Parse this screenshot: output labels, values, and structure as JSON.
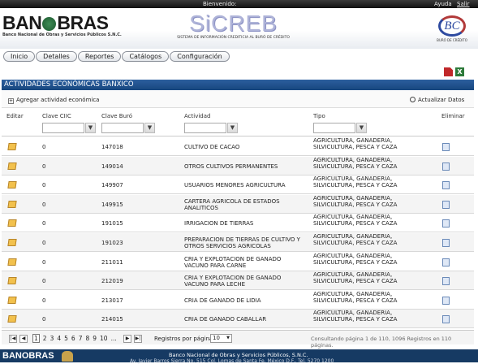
{
  "topbar": {
    "welcome": "Bienvenido:",
    "help": "Ayuda",
    "exit": "Salir"
  },
  "header": {
    "logo_left": "BAN",
    "logo_right": "BRAS",
    "logo_subtitle": "Banco Nacional de Obras y Servicios Públicos S.N.C.",
    "system_logo": "SiCREB",
    "system_subtitle": "SISTEMA DE INFORMACIÓN CREDITICIA AL BURÓ DE CRÉDITO",
    "buro_mark": "BC",
    "buro_subtitle": "BURÓ DE CRÉDITO"
  },
  "nav": [
    "Inicio",
    "Detalles",
    "Reportes",
    "Catálogos",
    "Configuración"
  ],
  "panel": {
    "title": "ACTIVIDADES ECONÓMICAS BANXICO",
    "add_label": "Agregar actividad económica",
    "refresh_label": "Actualizar Datos"
  },
  "columns": {
    "edit": "Editar",
    "clave_ciic": "Clave CIIC",
    "clave_buro": "Clave Buró",
    "actividad": "Actividad",
    "tipo": "Tipo",
    "eliminar": "Eliminar"
  },
  "rows": [
    {
      "ciic": "0",
      "buro": "147018",
      "actividad": "CULTIVO DE CACAO",
      "tipo": "AGRICULTURA, GANADERIA, SILVICULTURA, PESCA Y CAZA"
    },
    {
      "ciic": "0",
      "buro": "149014",
      "actividad": "OTROS CULTIVOS PERMANENTES",
      "tipo": "AGRICULTURA, GANADERIA, SILVICULTURA, PESCA Y CAZA"
    },
    {
      "ciic": "0",
      "buro": "149907",
      "actividad": "USUARIOS MENORES AGRICULTURA",
      "tipo": "AGRICULTURA, GANADERIA, SILVICULTURA, PESCA Y CAZA"
    },
    {
      "ciic": "0",
      "buro": "149915",
      "actividad": "CARTERA AGRICOLA DE ESTADOS ANALITICOS",
      "tipo": "AGRICULTURA, GANADERIA, SILVICULTURA, PESCA Y CAZA"
    },
    {
      "ciic": "0",
      "buro": "191015",
      "actividad": "IRRIGACION DE TIERRAS",
      "tipo": "AGRICULTURA, GANADERIA, SILVICULTURA, PESCA Y CAZA"
    },
    {
      "ciic": "0",
      "buro": "191023",
      "actividad": "PREPARACION DE TIERRAS DE CULTIVO Y OTROS SERVICIOS AGRICOLAS",
      "tipo": "AGRICULTURA, GANADERIA, SILVICULTURA, PESCA Y CAZA"
    },
    {
      "ciic": "0",
      "buro": "211011",
      "actividad": "CRIA Y EXPLOTACION DE GANADO VACUNO PARA CARNE",
      "tipo": "AGRICULTURA, GANADERIA, SILVICULTURA, PESCA Y CAZA"
    },
    {
      "ciic": "0",
      "buro": "212019",
      "actividad": "CRIA Y EXPLOTACION DE GANADO VACUNO PARA LECHE",
      "tipo": "AGRICULTURA, GANADERIA, SILVICULTURA, PESCA Y CAZA"
    },
    {
      "ciic": "0",
      "buro": "213017",
      "actividad": "CRIA DE GANADO DE LIDIA",
      "tipo": "AGRICULTURA, GANADERIA, SILVICULTURA, PESCA Y CAZA"
    },
    {
      "ciic": "0",
      "buro": "214015",
      "actividad": "CRIA DE GANADO CABALLAR",
      "tipo": "AGRICULTURA, GANADERIA, SILVICULTURA, PESCA Y CAZA"
    }
  ],
  "pager": {
    "first": "|◀",
    "prev": "◀",
    "next": "▶",
    "last": "▶|",
    "pages": [
      "1",
      "2",
      "3",
      "4",
      "5",
      "6",
      "7",
      "8",
      "9",
      "10",
      "..."
    ],
    "current_page": "1",
    "per_page_label": "Registros por página:",
    "per_page_value": "10",
    "info": "Consultando página 1 de 110, 1096 Registros en 110 páginas."
  },
  "footer": {
    "logo": "BANOBRAS",
    "bank_name": "Banco Nacional de Obras y Servicios Públicos, S.N.C.",
    "address": "Av. Javier Barros Sierra No. 515 Col. Lomas de Santa Fe, México D.F., Tel. 5270 1200"
  },
  "colors": {
    "accent": "#1f5591",
    "footer": "#163a63",
    "topbar": "#1b1b1b"
  }
}
